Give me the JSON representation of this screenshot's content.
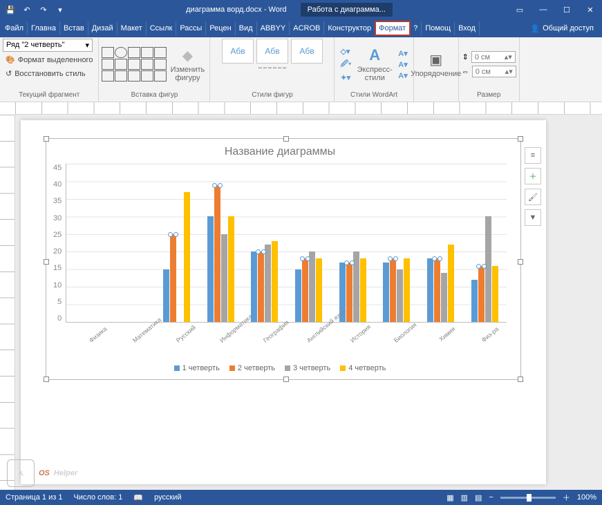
{
  "titlebar": {
    "doc_title": "диаграмма ворд.docx - Word",
    "contextual": "Работа с диаграмма..."
  },
  "menu": {
    "file": "Файл",
    "items": [
      "Главна",
      "Встав",
      "Дизай",
      "Макет",
      "Ссылк",
      "Рассы",
      "Рецен",
      "Вид",
      "ABBYY",
      "ACROB",
      "Конструктор",
      "Формат",
      "?",
      "Помощ",
      "Вход"
    ],
    "share": "Общий доступ",
    "active_index": 11
  },
  "ribbon": {
    "g1": {
      "combo": "Ряд \"2 четверть\"",
      "fmt_sel": "Формат выделенного",
      "reset": "Восстановить стиль",
      "label": "Текущий фрагмент"
    },
    "g2": {
      "edit_shape": "Изменить фигуру",
      "label": "Вставка фигур"
    },
    "g3": {
      "abv": "Абв",
      "label": "Стили фигур"
    },
    "g4": {
      "express": "Экспресс-стили",
      "label": "Стили WordArt"
    },
    "g5": {
      "arrange": "Упорядочение",
      "label": ""
    },
    "g6": {
      "h": "0 см",
      "w": "0 см",
      "label": "Размер"
    }
  },
  "chart_data": {
    "type": "bar",
    "title": "Название диаграммы",
    "ylim": [
      0,
      45
    ],
    "yticks": [
      0,
      5,
      10,
      15,
      20,
      25,
      30,
      35,
      40,
      45
    ],
    "categories": [
      "Физика",
      "Математика",
      "Русский",
      "Информатика",
      "География",
      "Английский язык",
      "История",
      "Биология",
      "Химия",
      "Физ-ра"
    ],
    "series": [
      {
        "name": "1 четверть",
        "color": "#5b9bd5",
        "values": [
          null,
          null,
          15,
          30,
          20,
          15,
          17,
          17,
          18,
          12
        ]
      },
      {
        "name": "2 четверть",
        "color": "#ed7d31",
        "values": [
          null,
          null,
          25,
          39,
          20,
          18,
          17,
          18,
          18,
          16
        ]
      },
      {
        "name": "3 четверть",
        "color": "#a5a5a5",
        "values": [
          null,
          null,
          null,
          25,
          22,
          20,
          20,
          15,
          14,
          30
        ]
      },
      {
        "name": "4 четверть",
        "color": "#ffc000",
        "values": [
          null,
          null,
          37,
          30,
          23,
          18,
          18,
          18,
          22,
          16
        ]
      }
    ],
    "selected_series": 1
  },
  "status": {
    "page": "Страница 1 из 1",
    "words": "Число слов: 1",
    "lang": "русский",
    "zoom": "100%"
  },
  "watermark": {
    "brand1": "OS",
    "brand2": "Helper"
  }
}
